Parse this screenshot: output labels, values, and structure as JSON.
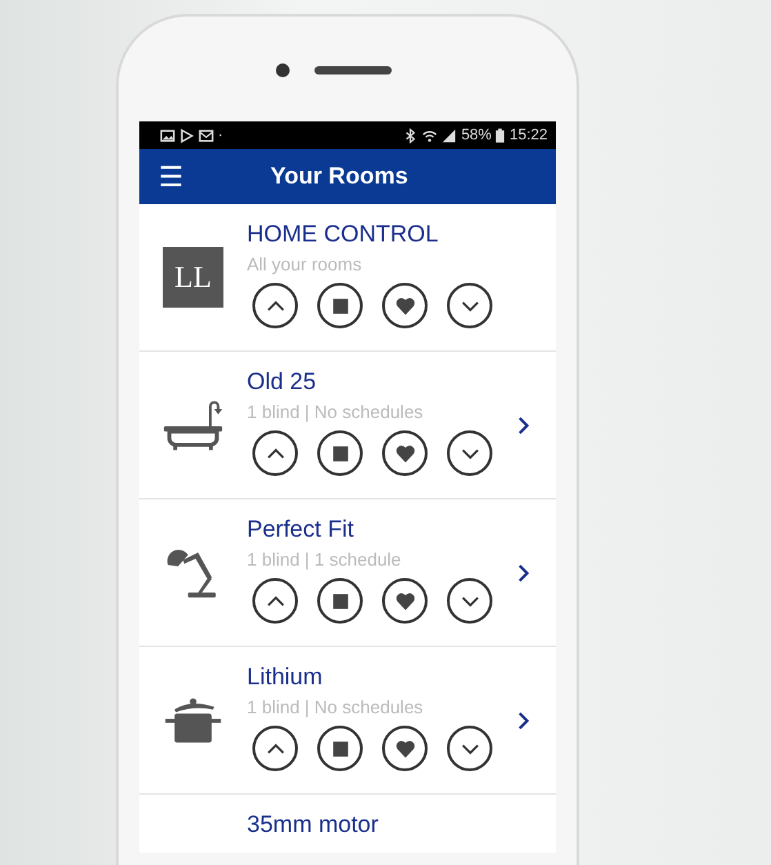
{
  "status_bar": {
    "battery": "58%",
    "time": "15:22",
    "dot": "·"
  },
  "app_bar": {
    "title": "Your Rooms",
    "menu": "☰"
  },
  "rooms": [
    {
      "kind": "logo",
      "logo_text": "LL",
      "name": "HOME CONTROL",
      "subtitle": "All your rooms",
      "controls": true,
      "chevron": false
    },
    {
      "kind": "bathtub",
      "name": "Old 25",
      "subtitle": "1 blind | No schedules",
      "controls": true,
      "chevron": true
    },
    {
      "kind": "lamp",
      "name": "Perfect Fit",
      "subtitle": "1 blind | 1 schedule",
      "controls": true,
      "chevron": true
    },
    {
      "kind": "pot",
      "name": "Lithium",
      "subtitle": "1 blind | No schedules",
      "controls": true,
      "chevron": true
    },
    {
      "kind": "none",
      "name": "35mm motor",
      "controls": false
    }
  ]
}
